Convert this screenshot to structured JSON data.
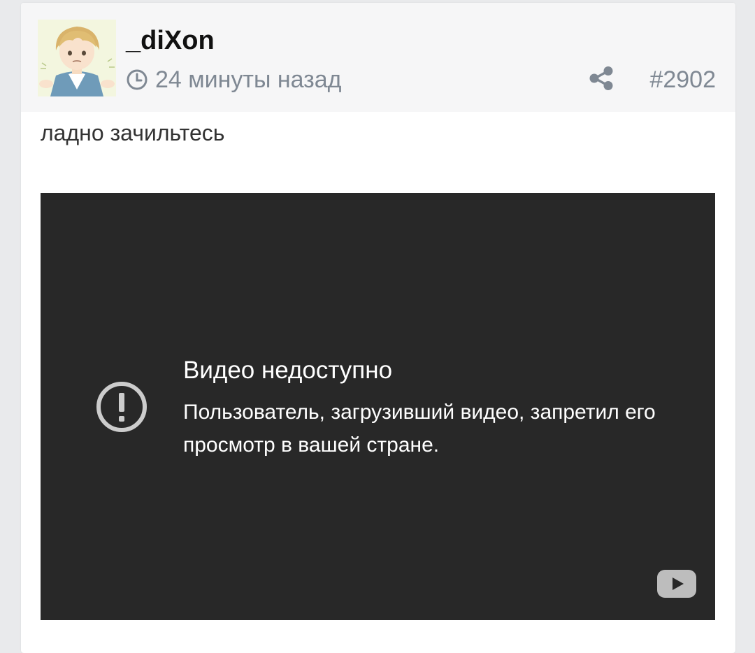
{
  "post": {
    "username": "_diXon",
    "time_ago": "24 минуты назад",
    "post_number": "#2902",
    "text": "ладно зачильтесь"
  },
  "video": {
    "title": "Видео недоступно",
    "message": "Пользователь, загрузивший видео, запретил его просмотр в вашей стране."
  },
  "icons": {
    "clock": "clock-icon",
    "share": "share-icon",
    "error": "exclamation-circle-icon",
    "youtube": "youtube-logo-icon"
  },
  "colors": {
    "header_bg": "#f6f6f7",
    "meta_text": "#7f8893",
    "video_bg": "#282828"
  }
}
